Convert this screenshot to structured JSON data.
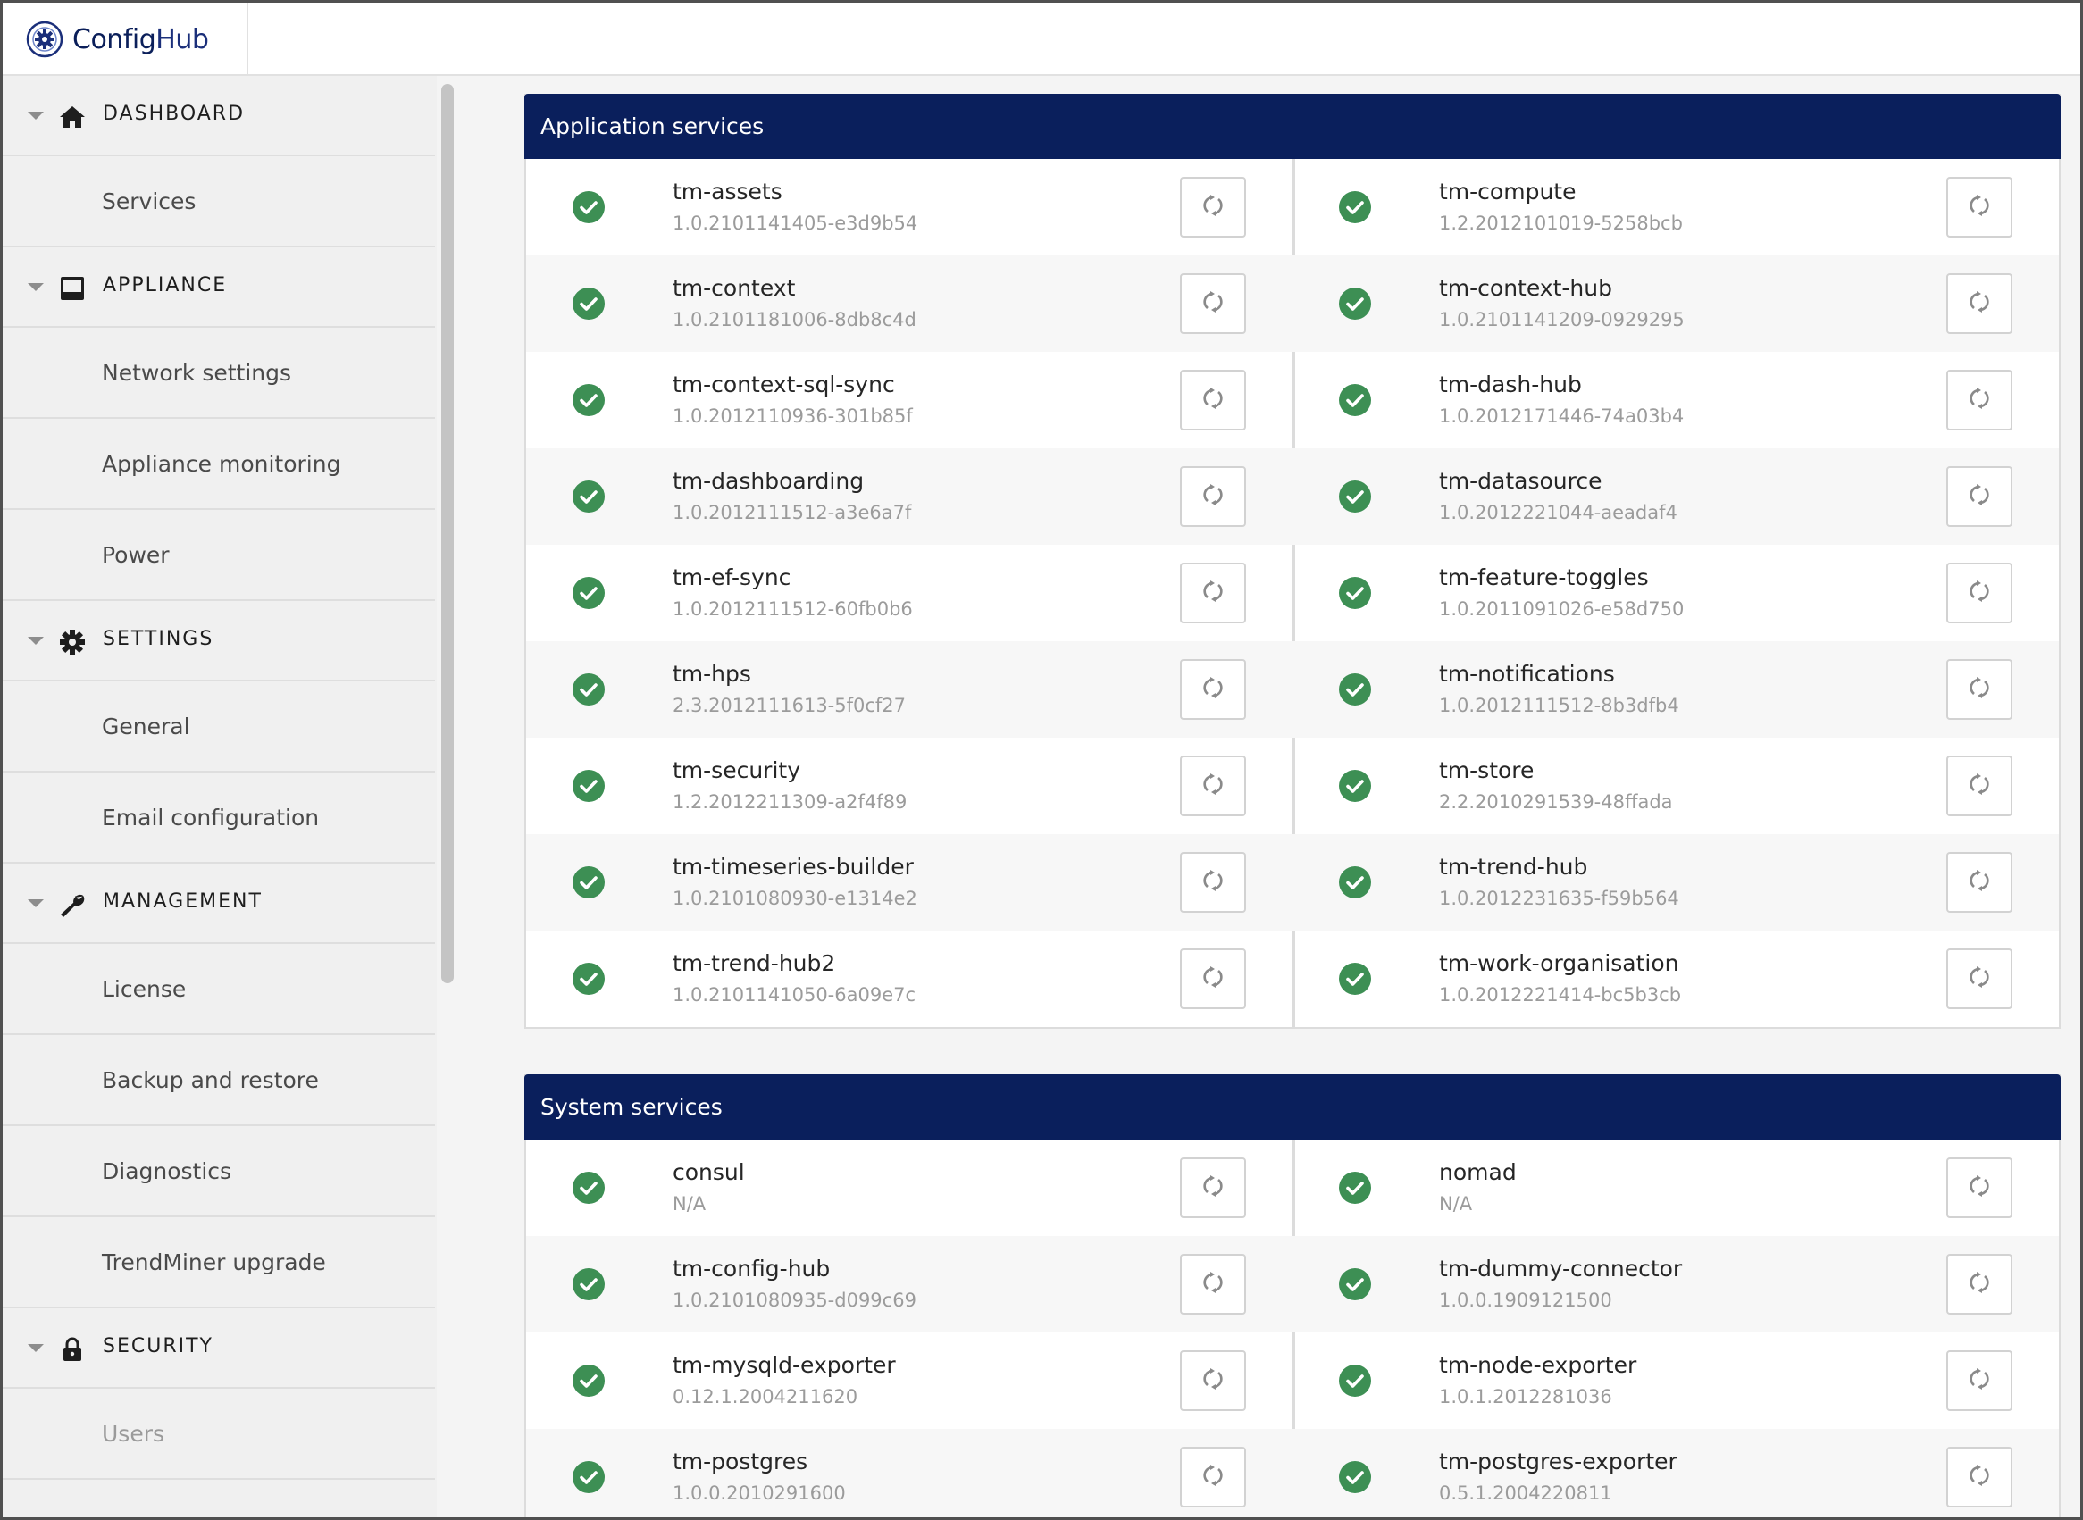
{
  "brand": {
    "name_a": "Config",
    "name_b": "Hub"
  },
  "sidebar": {
    "sections": [
      {
        "label": "DASHBOARD",
        "icon": "home-icon",
        "items": [
          "Services"
        ]
      },
      {
        "label": "APPLIANCE",
        "icon": "inbox-icon",
        "items": [
          "Network settings",
          "Appliance monitoring",
          "Power"
        ]
      },
      {
        "label": "SETTINGS",
        "icon": "gear-icon",
        "items": [
          "General",
          "Email configuration"
        ]
      },
      {
        "label": "MANAGEMENT",
        "icon": "wrench-icon",
        "items": [
          "License",
          "Backup and restore",
          "Diagnostics",
          "TrendMiner upgrade"
        ]
      },
      {
        "label": "SECURITY",
        "icon": "lock-icon",
        "items": [
          "Users"
        ]
      }
    ]
  },
  "colors": {
    "header_bg": "#0a1f5c",
    "check_green": "#3d8f54"
  },
  "application_services": {
    "title": "Application services",
    "left": [
      {
        "name": "tm-assets",
        "version": "1.0.2101141405-e3d9b54"
      },
      {
        "name": "tm-context",
        "version": "1.0.2101181006-8db8c4d"
      },
      {
        "name": "tm-context-sql-sync",
        "version": "1.0.2012110936-301b85f"
      },
      {
        "name": "tm-dashboarding",
        "version": "1.0.2012111512-a3e6a7f"
      },
      {
        "name": "tm-ef-sync",
        "version": "1.0.2012111512-60fb0b6"
      },
      {
        "name": "tm-hps",
        "version": "2.3.2012111613-5f0cf27"
      },
      {
        "name": "tm-security",
        "version": "1.2.2012211309-a2f4f89"
      },
      {
        "name": "tm-timeseries-builder",
        "version": "1.0.2101080930-e1314e2"
      },
      {
        "name": "tm-trend-hub2",
        "version": "1.0.2101141050-6a09e7c"
      }
    ],
    "right": [
      {
        "name": "tm-compute",
        "version": "1.2.2012101019-5258bcb"
      },
      {
        "name": "tm-context-hub",
        "version": "1.0.2101141209-0929295"
      },
      {
        "name": "tm-dash-hub",
        "version": "1.0.2012171446-74a03b4"
      },
      {
        "name": "tm-datasource",
        "version": "1.0.2012221044-aeadaf4"
      },
      {
        "name": "tm-feature-toggles",
        "version": "1.0.2011091026-e58d750"
      },
      {
        "name": "tm-notifications",
        "version": "1.0.2012111512-8b3dfb4"
      },
      {
        "name": "tm-store",
        "version": "2.2.2010291539-48ffada"
      },
      {
        "name": "tm-trend-hub",
        "version": "1.0.2012231635-f59b564"
      },
      {
        "name": "tm-work-organisation",
        "version": "1.0.2012221414-bc5b3cb"
      }
    ]
  },
  "system_services": {
    "title": "System services",
    "left": [
      {
        "name": "consul",
        "version": "N/A"
      },
      {
        "name": "tm-config-hub",
        "version": "1.0.2101080935-d099c69"
      },
      {
        "name": "tm-mysqld-exporter",
        "version": "0.12.1.2004211620"
      },
      {
        "name": "tm-postgres",
        "version": "1.0.0.2010291600"
      }
    ],
    "right": [
      {
        "name": "nomad",
        "version": "N/A"
      },
      {
        "name": "tm-dummy-connector",
        "version": "1.0.0.1909121500"
      },
      {
        "name": "tm-node-exporter",
        "version": "1.0.1.2012281036"
      },
      {
        "name": "tm-postgres-exporter",
        "version": "0.5.1.2004220811"
      }
    ]
  }
}
